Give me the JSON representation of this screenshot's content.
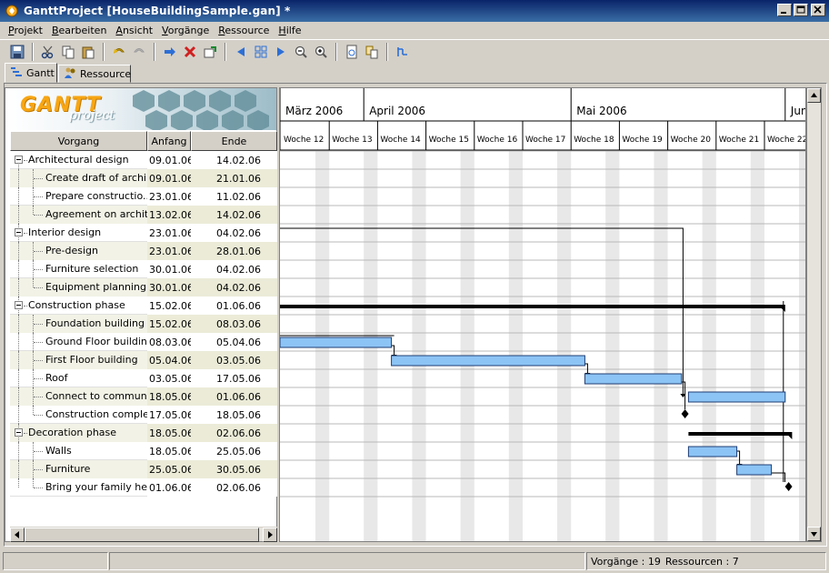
{
  "window": {
    "title": "GanttProject [HouseBuildingSample.gan] *"
  },
  "menu": [
    {
      "label": "Projekt",
      "u": "P",
      "rest": "rojekt"
    },
    {
      "label": "Bearbeiten",
      "u": "B",
      "rest": "earbeiten"
    },
    {
      "label": "Ansicht",
      "u": "A",
      "rest": "nsicht"
    },
    {
      "label": "Vorgänge",
      "u": "V",
      "rest": "orgänge"
    },
    {
      "label": "Ressource",
      "u": "R",
      "rest": "essource"
    },
    {
      "label": "Hilfe",
      "u": "H",
      "rest": "ilfe"
    }
  ],
  "tabs": [
    {
      "label": "Gantt",
      "active": true
    },
    {
      "label": "Ressource",
      "active": false
    }
  ],
  "logo": {
    "main": "GANTT",
    "sub": "project"
  },
  "table": {
    "headers": {
      "name": "Vorgang",
      "start": "Anfang",
      "end": "Ende"
    },
    "rows": [
      {
        "name": "Architectural design",
        "start": "09.01.06",
        "end": "14.02.06",
        "level": 0,
        "group": true
      },
      {
        "name": "Create draft of archi...",
        "start": "09.01.06",
        "end": "21.01.06",
        "level": 1
      },
      {
        "name": "Prepare constructio...",
        "start": "23.01.06",
        "end": "11.02.06",
        "level": 1
      },
      {
        "name": "Agreement on archit...",
        "start": "13.02.06",
        "end": "14.02.06",
        "level": 1
      },
      {
        "name": "Interior design",
        "start": "23.01.06",
        "end": "04.02.06",
        "level": 0,
        "group": true
      },
      {
        "name": "Pre-design",
        "start": "23.01.06",
        "end": "28.01.06",
        "level": 1
      },
      {
        "name": "Furniture selection",
        "start": "30.01.06",
        "end": "04.02.06",
        "level": 1
      },
      {
        "name": "Equipment planning",
        "start": "30.01.06",
        "end": "04.02.06",
        "level": 1
      },
      {
        "name": "Construction phase",
        "start": "15.02.06",
        "end": "01.06.06",
        "level": 0,
        "group": true
      },
      {
        "name": "Foundation building",
        "start": "15.02.06",
        "end": "08.03.06",
        "level": 1
      },
      {
        "name": "Ground Floor building",
        "start": "08.03.06",
        "end": "05.04.06",
        "level": 1
      },
      {
        "name": "First Floor building",
        "start": "05.04.06",
        "end": "03.05.06",
        "level": 1
      },
      {
        "name": "Roof",
        "start": "03.05.06",
        "end": "17.05.06",
        "level": 1
      },
      {
        "name": "Connect to communi...",
        "start": "18.05.06",
        "end": "01.06.06",
        "level": 1
      },
      {
        "name": "Construction comple...",
        "start": "17.05.06",
        "end": "18.05.06",
        "level": 1
      },
      {
        "name": "Decoration phase",
        "start": "18.05.06",
        "end": "02.06.06",
        "level": 0,
        "group": true
      },
      {
        "name": "Walls",
        "start": "18.05.06",
        "end": "25.05.06",
        "level": 1
      },
      {
        "name": "Furniture",
        "start": "25.05.06",
        "end": "30.05.06",
        "level": 1
      },
      {
        "name": "Bring your family here",
        "start": "01.06.06",
        "end": "02.06.06",
        "level": 1
      }
    ]
  },
  "timeline": {
    "months": [
      "März 2006",
      "April 2006",
      "Mai 2006",
      "Jun"
    ],
    "weeks": [
      "Woche 12",
      "Woche 13",
      "Woche 14",
      "Woche 15",
      "Woche 16",
      "Woche 17",
      "Woche 18",
      "Woche 19",
      "Woche 20",
      "Woche 21",
      "Woche 22"
    ]
  },
  "status": {
    "tasks_label": "Vorgänge : 19",
    "resources_label": "Ressourcen : 7"
  },
  "colors": {
    "bar_fill": "#8cc4f5",
    "bar_border": "#1f3e73",
    "weekend": "#e8e8e8",
    "title_gradient_start": "#0a246a",
    "title_gradient_end": "#3a6ea5"
  }
}
